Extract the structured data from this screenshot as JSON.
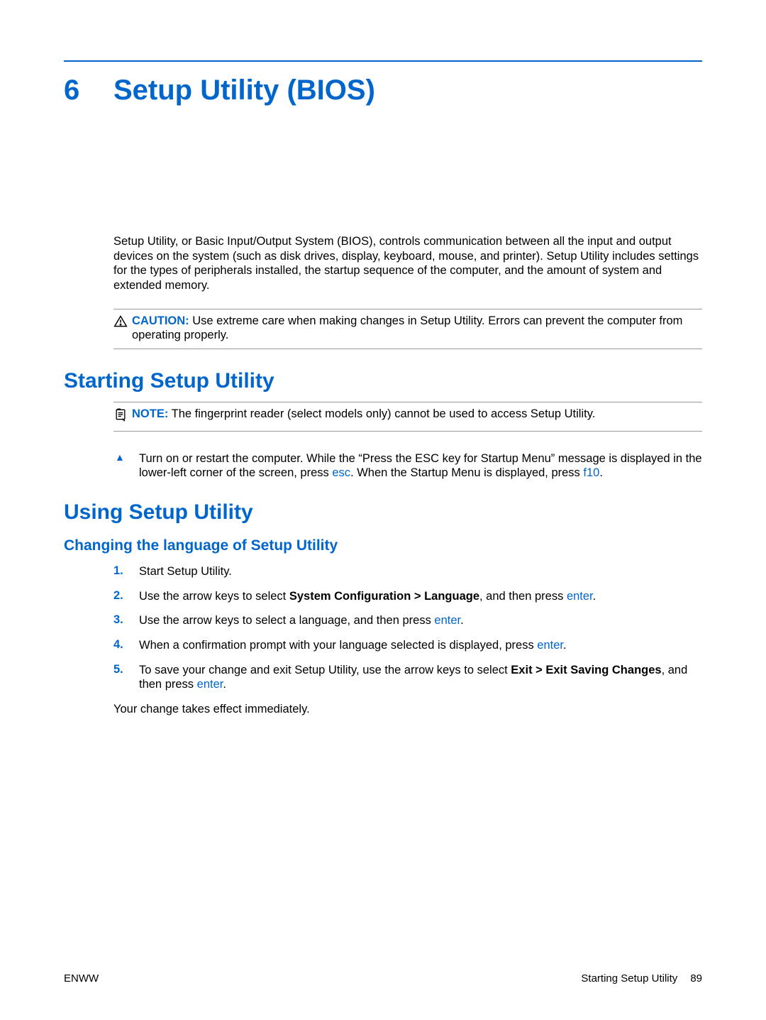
{
  "chapter": {
    "number": "6",
    "title": "Setup Utility (BIOS)"
  },
  "intro": "Setup Utility, or Basic Input/Output System (BIOS), controls communication between all the input and output devices on the system (such as disk drives, display, keyboard, mouse, and printer). Setup Utility includes settings for the types of peripherals installed, the startup sequence of the computer, and the amount of system and extended memory.",
  "caution": {
    "label": "CAUTION:",
    "text": "Use extreme care when making changes in Setup Utility. Errors can prevent the computer from operating properly."
  },
  "section1": {
    "heading": "Starting Setup Utility",
    "note": {
      "label": "NOTE:",
      "text": "The fingerprint reader (select models only) cannot be used to access Setup Utility."
    },
    "step": {
      "pre": "Turn on or restart the computer. While the “Press the ESC key for Startup Menu” message is displayed in the lower-left corner of the screen, press ",
      "key1": "esc",
      "mid": ". When the Startup Menu is displayed, press ",
      "key2": "f10",
      "post": "."
    }
  },
  "section2": {
    "heading": "Using Setup Utility",
    "sub1": {
      "heading": "Changing the language of Setup Utility",
      "steps": {
        "s1": {
          "num": "1.",
          "text": "Start Setup Utility."
        },
        "s2": {
          "num": "2.",
          "pre": "Use the arrow keys to select ",
          "bold": "System Configuration > Language",
          "mid": ", and then press ",
          "key": "enter",
          "post": "."
        },
        "s3": {
          "num": "3.",
          "pre": "Use the arrow keys to select a language, and then press ",
          "key": "enter",
          "post": "."
        },
        "s4": {
          "num": "4.",
          "pre": "When a confirmation prompt with your language selected is displayed, press ",
          "key": "enter",
          "post": "."
        },
        "s5": {
          "num": "5.",
          "pre": "To save your change and exit Setup Utility, use the arrow keys to select ",
          "bold": "Exit > Exit Saving Changes",
          "mid": ", and then press ",
          "key": "enter",
          "post": "."
        }
      },
      "after": "Your change takes effect immediately."
    }
  },
  "footer": {
    "left": "ENWW",
    "right_text": "Starting Setup Utility",
    "page": "89"
  }
}
